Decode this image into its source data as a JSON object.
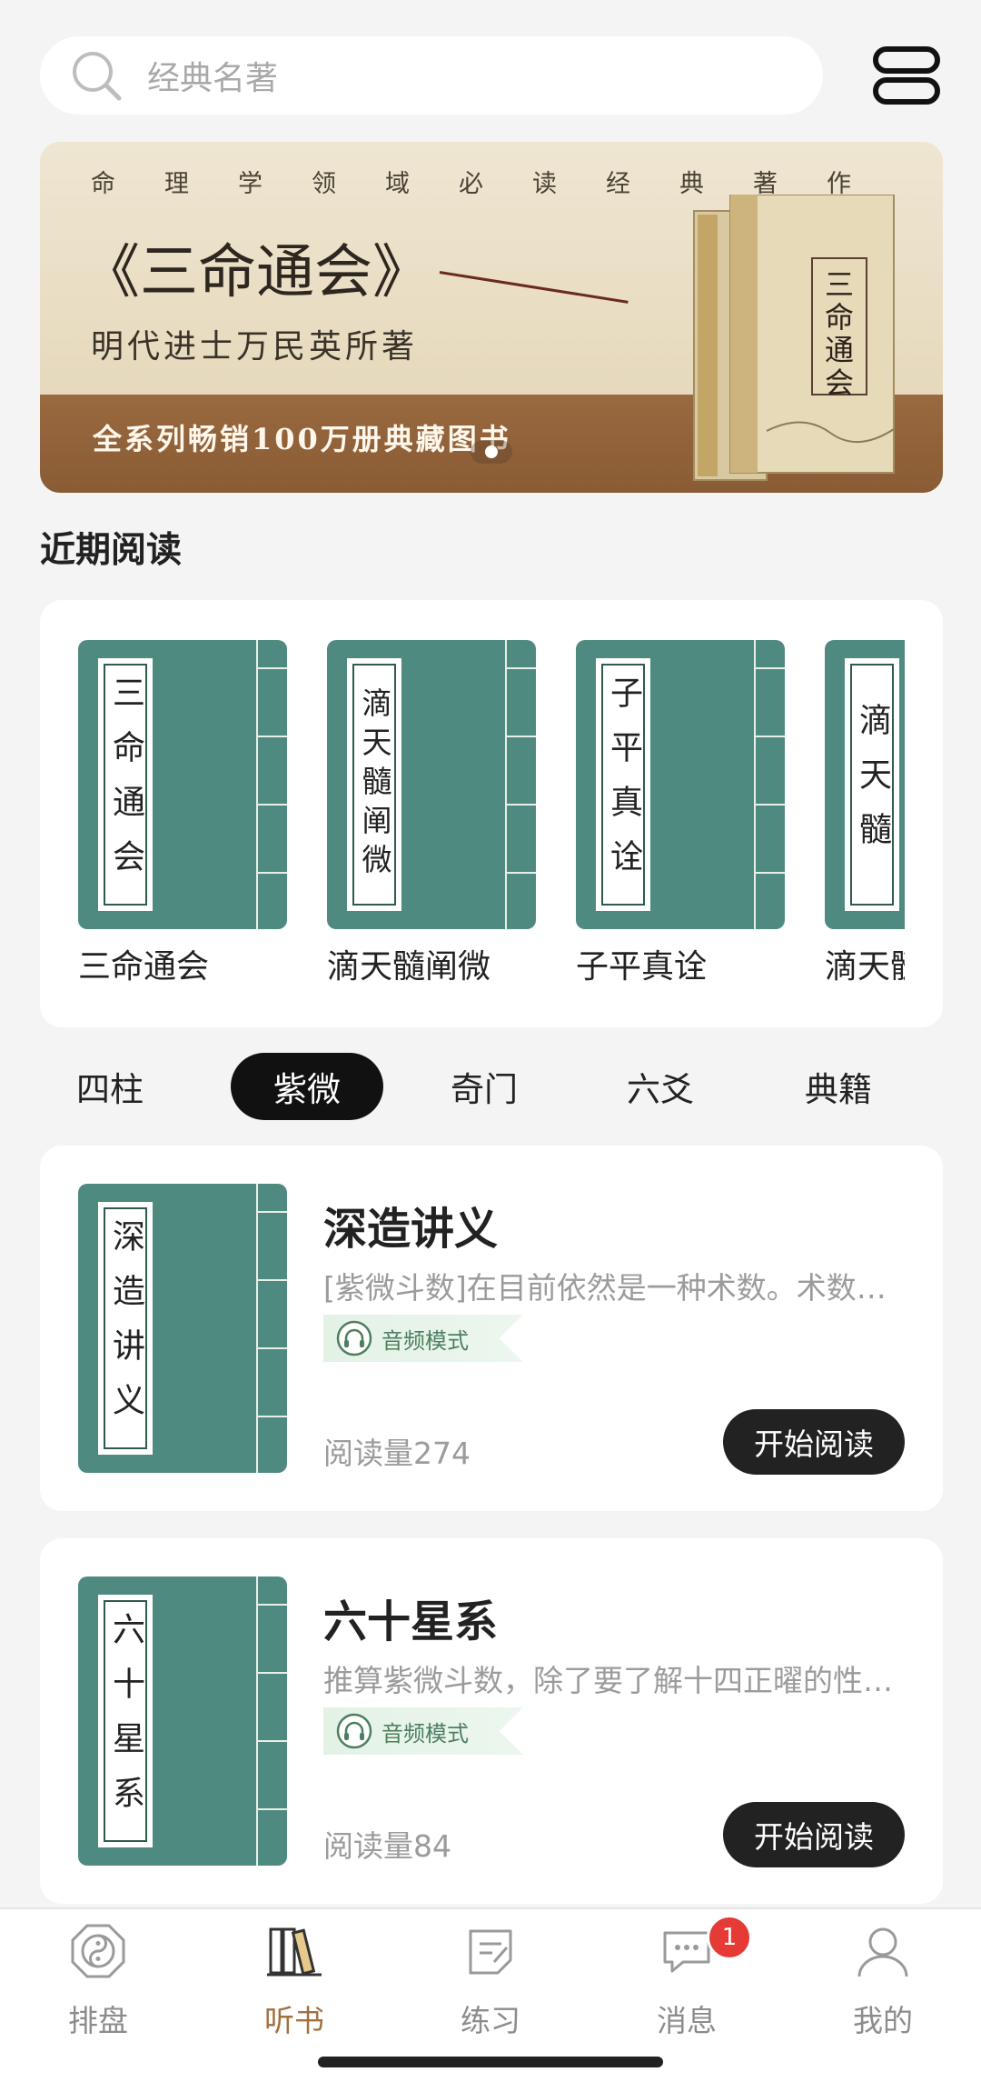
{
  "search": {
    "placeholder": "经典名著"
  },
  "banner": {
    "tagline": "命理学领域必读经典著作",
    "title": "《三命通会》",
    "author": "明代进士万民英所著",
    "strip_text": "全系列畅销100万册典藏图书",
    "book_cover_text": "三命通会"
  },
  "recent": {
    "title": "近期阅读",
    "items": [
      {
        "cover": "三命通会",
        "name": "三命通会"
      },
      {
        "cover": "滴天髓阐微",
        "name": "滴天髓阐微"
      },
      {
        "cover": "子平真诠",
        "name": "子平真诠"
      },
      {
        "cover": "滴天髓",
        "name": "滴天髓"
      }
    ]
  },
  "tabs": [
    "四柱",
    "紫微",
    "奇门",
    "六爻",
    "典籍"
  ],
  "active_tab": "紫微",
  "books": [
    {
      "cover": "深造讲义",
      "title": "深造讲义",
      "desc": "[紫微斗数]在目前依然是一种术数。术数的演化",
      "badge": "音频模式",
      "reads": "阅读量274",
      "button": "开始阅读"
    },
    {
      "cover": "六十星系",
      "title": "六十星系",
      "desc": "推算紫微斗数，除了要了解十四正曜的性质之外",
      "badge": "音频模式",
      "reads": "阅读量84",
      "button": "开始阅读"
    }
  ],
  "nav": {
    "items": [
      "排盘",
      "听书",
      "练习",
      "消息",
      "我的"
    ],
    "active": "听书",
    "message_badge": "1"
  },
  "colors": {
    "accent": "#a2713f",
    "cover_green": "#4f8a80",
    "badge_red": "#e53a36"
  }
}
